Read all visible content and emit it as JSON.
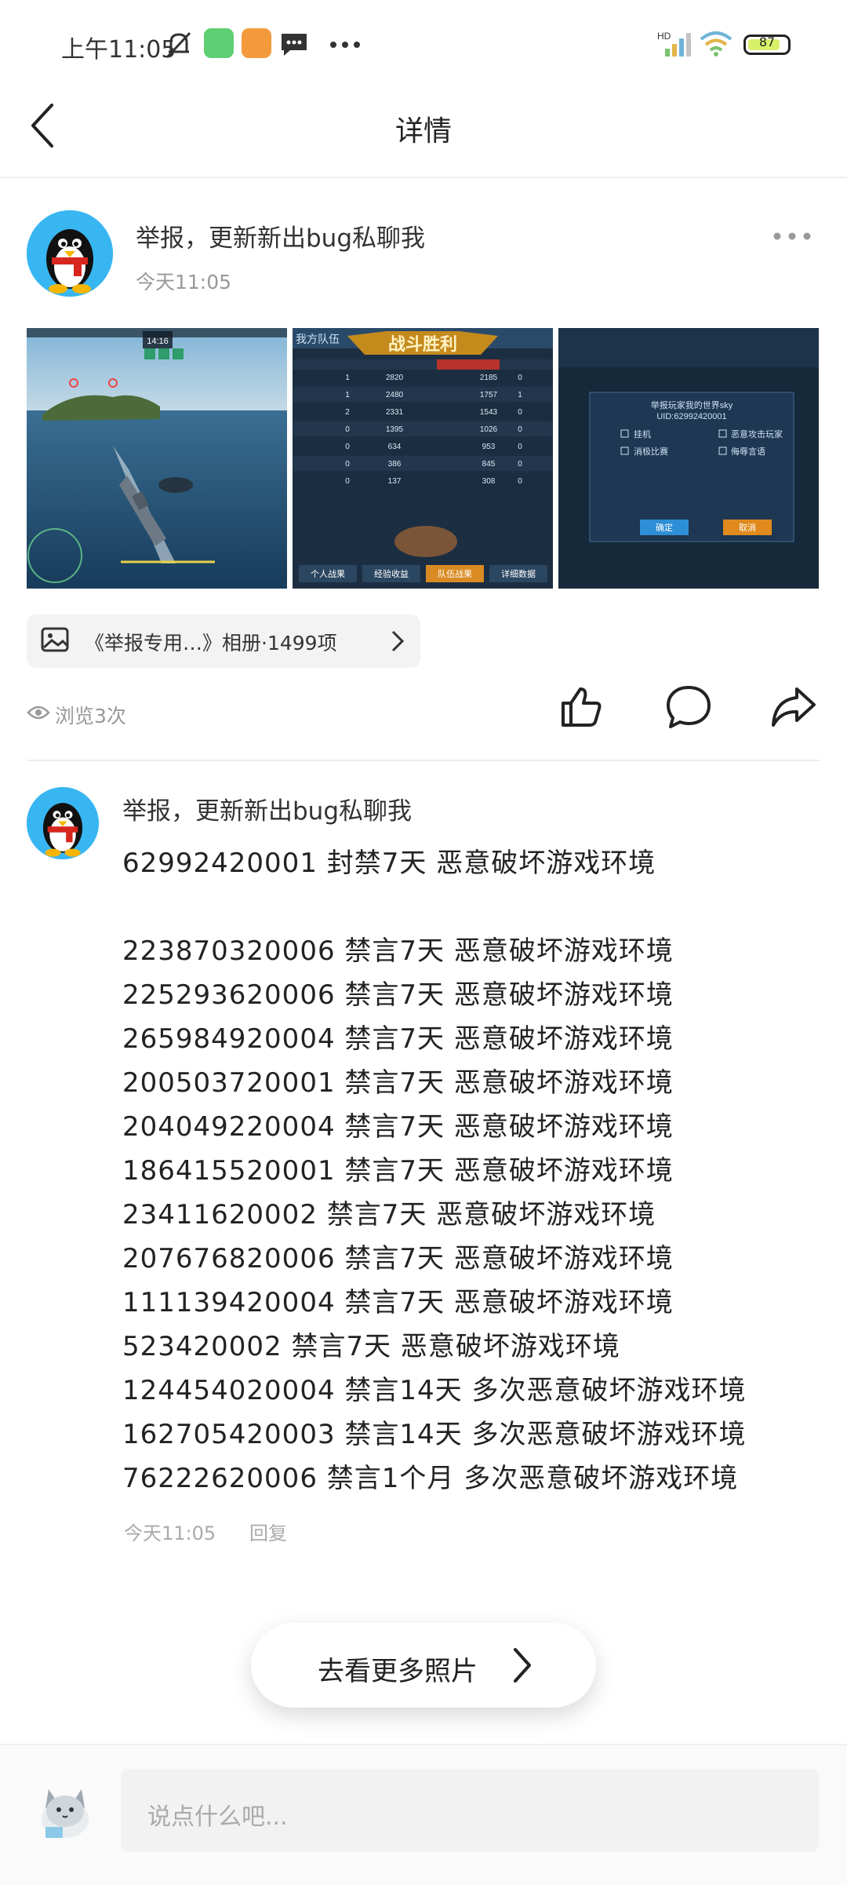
{
  "status_bar": {
    "time": "上午11:05",
    "network": "HD",
    "battery": "87"
  },
  "header": {
    "title": "详情"
  },
  "post": {
    "title": "举报，更新新出bug私聊我",
    "time": "今天11:05",
    "album_label": "《举报专用…》相册·1499项",
    "views": "浏览3次"
  },
  "photos": {
    "p2_header_left": "我方队伍",
    "p2_banner": "战斗胜利",
    "p2_tabs": [
      "个人战果",
      "经验收益",
      "队伍战果",
      "详细数据"
    ],
    "p2_rows": [
      [
        "1",
        "2820",
        "2185",
        "0"
      ],
      [
        "1",
        "2480",
        "1757",
        "1"
      ],
      [
        "2",
        "2331",
        "1543",
        "0"
      ],
      [
        "0",
        "1395",
        "1026",
        "0"
      ],
      [
        "0",
        "634",
        "953",
        "0"
      ],
      [
        "0",
        "386",
        "845",
        "0"
      ],
      [
        "0",
        "137",
        "308",
        "0"
      ]
    ],
    "p3_title": "举报玩家我的世界sky",
    "p3_uid": "UID:62992420001",
    "p3_options": [
      "挂机",
      "恶意攻击玩家",
      "消极比赛",
      "侮辱言语"
    ],
    "p3_confirm": "确定",
    "p3_cancel": "取消",
    "p1_timer": "14:16"
  },
  "comment": {
    "title": "举报，更新新出bug私聊我",
    "lines": [
      "62992420001    封禁7天 恶意破坏游戏环境",
      "",
      "223870320006 禁言7天 恶意破坏游戏环境",
      "225293620006 禁言7天 恶意破坏游戏环境",
      "265984920004 禁言7天 恶意破坏游戏环境",
      "200503720001 禁言7天 恶意破坏游戏环境",
      "204049220004 禁言7天 恶意破坏游戏环境",
      "186415520001 禁言7天 恶意破坏游戏环境",
      "23411620002 禁言7天 恶意破坏游戏环境",
      "207676820006 禁言7天 恶意破坏游戏环境",
      "111139420004 禁言7天 恶意破坏游戏环境",
      "523420002 禁言7天 恶意破坏游戏环境",
      "124454020004 禁言14天 多次恶意破坏游戏环境",
      "162705420003 禁言14天 多次恶意破坏游戏环境",
      "76222620006 禁言1个月 多次恶意破坏游戏环境"
    ],
    "time": "今天11:05",
    "reply": "回复"
  },
  "more_photos": "去看更多照片",
  "input": {
    "placeholder": "说点什么吧..."
  },
  "colors": {
    "avatar_bg": "#38b6f2",
    "sea": "#1d4e73",
    "battery_fill": "#d8f16a",
    "confirm_blue": "#2d8fd6",
    "cancel_orange": "#e08a1e"
  }
}
